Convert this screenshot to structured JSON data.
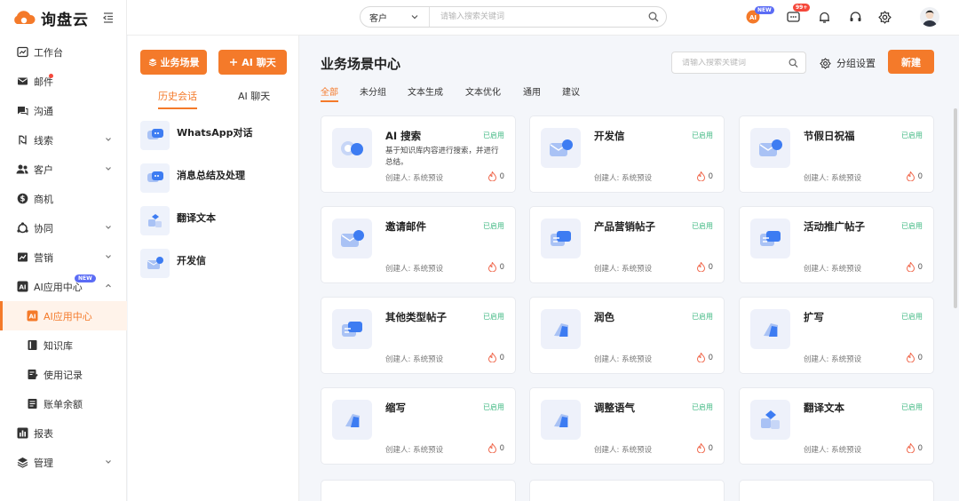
{
  "brand": {
    "name": "询盘云"
  },
  "sidebar": {
    "items": [
      {
        "label": "工作台",
        "icon": "dashboard-icon"
      },
      {
        "label": "邮件",
        "icon": "mail-icon",
        "dot": true
      },
      {
        "label": "沟通",
        "icon": "chat-icon"
      },
      {
        "label": "线索",
        "icon": "leads-icon",
        "chevron": true
      },
      {
        "label": "客户",
        "icon": "customers-icon",
        "chevron": true
      },
      {
        "label": "商机",
        "icon": "opportunity-icon"
      },
      {
        "label": "协同",
        "icon": "collaboration-icon",
        "chevron": true
      },
      {
        "label": "营销",
        "icon": "marketing-icon",
        "chevron": true
      },
      {
        "label": "AI应用中心",
        "icon": "ai-icon",
        "chevron_up": true,
        "badge": "NEW"
      },
      {
        "label": "AI应用中心",
        "icon": "ai-icon",
        "sub": true,
        "active": true
      },
      {
        "label": "知识库",
        "icon": "book-icon",
        "sub": true
      },
      {
        "label": "使用记录",
        "icon": "record-icon",
        "sub": true
      },
      {
        "label": "账单余额",
        "icon": "bill-icon",
        "sub": true
      },
      {
        "label": "报表",
        "icon": "report-icon"
      },
      {
        "label": "管理",
        "icon": "settings-layers-icon",
        "chevron": true
      }
    ]
  },
  "header": {
    "search_scope": "客户",
    "search_placeholder": "请输入搜索关键词",
    "ai_badge": "NEW",
    "message_badge": "99+"
  },
  "history": {
    "scene_button": "业务场景",
    "ai_chat_button": "AI 聊天",
    "tab_history": "历史会话",
    "tab_ai_chat": "AI 聊天",
    "items": [
      {
        "label": "WhatsApp对话"
      },
      {
        "label": "消息总结及处理"
      },
      {
        "label": "翻译文本"
      },
      {
        "label": "开发信"
      }
    ]
  },
  "main": {
    "title": "业务场景中心",
    "keyword_placeholder": "请输入搜索关键词",
    "group_settings": "分组设置",
    "new_button": "新建",
    "tabs": [
      {
        "label": "全部",
        "active": true
      },
      {
        "label": "未分组"
      },
      {
        "label": "文本生成"
      },
      {
        "label": "文本优化"
      },
      {
        "label": "通用"
      },
      {
        "label": "建议"
      }
    ],
    "cards": [
      {
        "title": "AI 搜索",
        "status": "已启用",
        "desc": "基于知识库内容进行搜索，并进行总结。",
        "creator": "创建人: 系统预设",
        "hot": "0"
      },
      {
        "title": "开发信",
        "status": "已启用",
        "desc": "",
        "creator": "创建人: 系统预设",
        "hot": "0"
      },
      {
        "title": "节假日祝福",
        "status": "已启用",
        "desc": "",
        "creator": "创建人: 系统预设",
        "hot": "0"
      },
      {
        "title": "邀请邮件",
        "status": "已启用",
        "desc": "",
        "creator": "创建人: 系统预设",
        "hot": "0"
      },
      {
        "title": "产品营销帖子",
        "status": "已启用",
        "desc": "",
        "creator": "创建人: 系统预设",
        "hot": "0"
      },
      {
        "title": "活动推广帖子",
        "status": "已启用",
        "desc": "",
        "creator": "创建人: 系统预设",
        "hot": "0"
      },
      {
        "title": "其他类型帖子",
        "status": "已启用",
        "desc": "",
        "creator": "创建人: 系统预设",
        "hot": "0"
      },
      {
        "title": "润色",
        "status": "已启用",
        "desc": "",
        "creator": "创建人: 系统预设",
        "hot": "0"
      },
      {
        "title": "扩写",
        "status": "已启用",
        "desc": "",
        "creator": "创建人: 系统预设",
        "hot": "0"
      },
      {
        "title": "缩写",
        "status": "已启用",
        "desc": "",
        "creator": "创建人: 系统预设",
        "hot": "0"
      },
      {
        "title": "调整语气",
        "status": "已启用",
        "desc": "",
        "creator": "创建人: 系统预设",
        "hot": "0"
      },
      {
        "title": "翻译文本",
        "status": "已启用",
        "desc": "",
        "creator": "创建人: 系统预设",
        "hot": "0"
      }
    ]
  },
  "colors": {
    "accent": "#f47a2a",
    "status_green": "#41b883",
    "badge_blue": "#5b6cf5",
    "badge_red": "#f5483b"
  }
}
